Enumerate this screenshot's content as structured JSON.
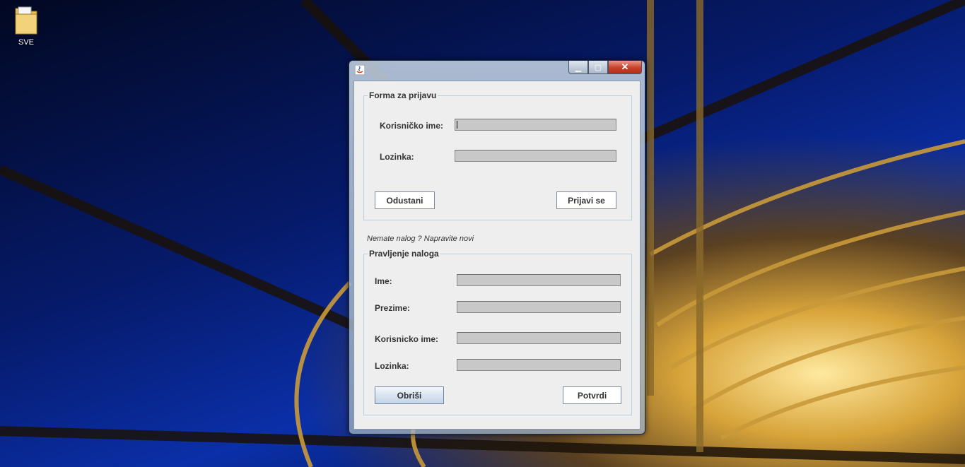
{
  "desktop": {
    "icon_label": "SVE"
  },
  "window": {
    "caption_buttons": {
      "minimize": "▁",
      "maximize": "▢",
      "close": "✕"
    }
  },
  "login": {
    "legend": "Forma za prijavu",
    "username_label": "Korisničko ime:",
    "username_value": "",
    "password_label": "Lozinka:",
    "password_value": "",
    "cancel_label": "Odustani",
    "submit_label": "Prijavi se"
  },
  "hint": "Nemate nalog ? Napravite novi",
  "register": {
    "legend": "Pravljenje naloga",
    "first_name_label": "Ime:",
    "last_name_label": "Prezime:",
    "username_label": "Korisnicko ime:",
    "password_label": "Lozinka:",
    "clear_label": "Obriši",
    "confirm_label": "Potvrdi"
  },
  "colors": {
    "field_bg": "#c8c8c8",
    "panel_bg": "#eeeeee",
    "group_border": "#b8cfe0"
  }
}
